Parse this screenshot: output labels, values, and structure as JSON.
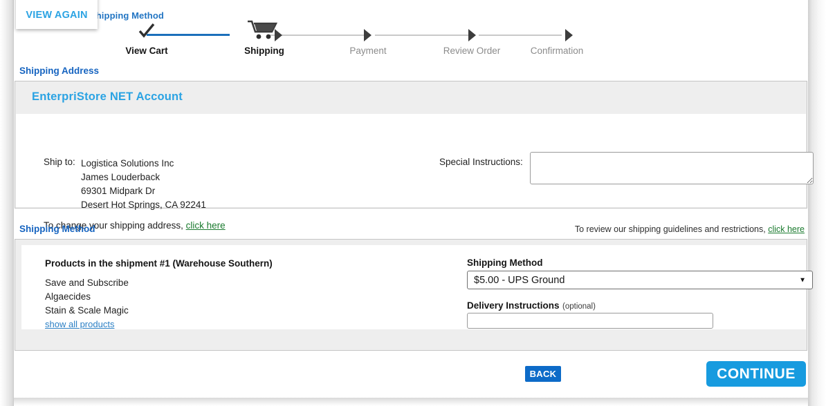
{
  "overlay": {
    "view_again_label": "VIEW AGAIN"
  },
  "progress": {
    "title": "Shipping Method",
    "steps": [
      {
        "label": "View Cart",
        "state": "complete",
        "icon": "check-icon"
      },
      {
        "label": "Shipping",
        "state": "active",
        "icon": "shopping-cart-icon"
      },
      {
        "label": "Payment",
        "state": "todo",
        "icon": "arrow-right-icon"
      },
      {
        "label": "Review Order",
        "state": "todo",
        "icon": "arrow-right-icon"
      },
      {
        "label": "Confirmation",
        "state": "todo",
        "icon": "arrow-right-icon"
      }
    ]
  },
  "shipping_address": {
    "heading": "Shipping Address",
    "account_title": "EnterpriStore NET Account",
    "ship_to_label": "Ship to:",
    "address_lines": [
      "Logistica Solutions Inc",
      "James Louderback",
      "69301 Midpark Dr",
      "Desert Hot Springs, CA 92241"
    ],
    "change_text": "To change your shipping address,",
    "change_link": "click here",
    "special_instructions_label": "Special Instructions:",
    "special_instructions_value": "",
    "special_instructions_placeholder": ""
  },
  "shipping_method": {
    "heading": "Shipping Method",
    "guidelines_text": "To review our shipping guidelines and restrictions,",
    "guidelines_link": "click here",
    "shipment_title": "Products in the shipment #1 (Warehouse Southern)",
    "products": [
      "Save and Subscribe",
      "Algaecides",
      "Stain & Scale Magic"
    ],
    "show_all_link": "show all products",
    "method_label": "Shipping Method",
    "method_selected": "$5.00 - UPS Ground",
    "method_options": [
      "$5.00 - UPS Ground"
    ],
    "delivery_label": "Delivery Instructions",
    "delivery_optional": "(optional)",
    "delivery_value": "",
    "delivery_placeholder": ""
  },
  "footer": {
    "back_label": "BACK",
    "continue_label": "CONTINUE"
  },
  "colors": {
    "heading_blue": "#1664c0",
    "account_blue": "#2ba3e3",
    "progress_done": "#1b6fbb",
    "green_link": "#1a7a2e",
    "blue_link": "#2b7fc4",
    "back_button": "#0d6bc8",
    "continue_button": "#179bdf",
    "panel_gray": "#eeeeee"
  }
}
